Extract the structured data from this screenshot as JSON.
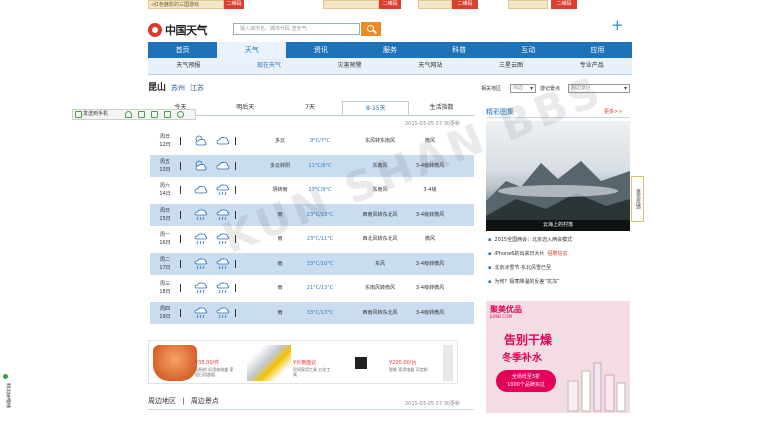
{
  "top_ads": {
    "text1": "«红色魅影的三国游戏",
    "tag1": "二维码",
    "tag2": "二维码",
    "tag3": "二维码",
    "tag4": "二维码"
  },
  "header": {
    "logo": "中国天气",
    "search_placeholder": "输入城市名、城市代码 查天气",
    "plus": "+"
  },
  "nav": {
    "items": [
      "首页",
      "天气",
      "资讯",
      "服务",
      "科普",
      "互动",
      "应用"
    ],
    "active_index": 1
  },
  "subnav": {
    "items": [
      "天气预报",
      "现在天气",
      "灾害预警",
      "天气网站",
      "三星云图",
      "专业产品"
    ]
  },
  "location": {
    "city": "昆山",
    "parent1": "苏州",
    "parent2": "江苏",
    "related_label": "相关地区",
    "related_value": "周边",
    "travel_label": "游记景点",
    "travel_value": "周边景区"
  },
  "forecast": {
    "tabs": [
      "今天",
      "明后天",
      "7天",
      "8-15天",
      "生活指数"
    ],
    "active_tab_index": 3,
    "updated": "2015-03-05 07:30更新",
    "rows": [
      {
        "day": "周日",
        "date": "12日",
        "desc": "多云",
        "temp": "9°C/7°C",
        "wind_dir": "东风转东南风",
        "wind_level": "微风"
      },
      {
        "day": "周五",
        "date": "13日",
        "desc": "多云转阴",
        "temp": "11°C/6°C",
        "wind_dir": "东南风",
        "wind_level": "3-4级转微风"
      },
      {
        "day": "周六",
        "date": "14日",
        "desc": "阴转雨",
        "temp": "17°C/9°C",
        "wind_dir": "东南风",
        "wind_level": "3-4级"
      },
      {
        "day": "周日",
        "date": "15日",
        "desc": "雨",
        "temp": "23°C/13°C",
        "wind_dir": "西南风转东北风",
        "wind_level": "3-4级转微风"
      },
      {
        "day": "周一",
        "date": "16日",
        "desc": "雨",
        "temp": "23°C/11°C",
        "wind_dir": "西北风转东北风",
        "wind_level": "微风"
      },
      {
        "day": "周二",
        "date": "17日",
        "desc": "雨",
        "temp": "33°C/10°C",
        "wind_dir": "东风",
        "wind_level": "3-4级转微风"
      },
      {
        "day": "周三",
        "date": "18日",
        "desc": "雨",
        "temp": "21°C/13°C",
        "wind_dir": "东南风转南风",
        "wind_level": "3-4级转微风"
      },
      {
        "day": "周四",
        "date": "19日",
        "desc": "雨",
        "temp": "33°C/13°C",
        "wind_dir": "西南风转东北风",
        "wind_level": "3-4级转微风"
      }
    ]
  },
  "bottom_ads": {
    "price1": "¥38.00/件",
    "text1": "妈妈的 好用收纳盒 家居日用超值",
    "price2": "¥价格面议",
    "text2": "民间家用工具 五金工具",
    "price3": "¥200.00/台",
    "text3": "智能 家用电器 可定制"
  },
  "nearby": {
    "title1": "周边地区",
    "title2": "周边景点",
    "updated": "2015-03-05 07:30更新"
  },
  "sidebar": {
    "title": "精彩图集",
    "more": "更多>>",
    "photo_caption": "云海上的村落",
    "news": [
      {
        "text": "2015全国两会：北京迈入两会模式",
        "hot": ""
      },
      {
        "text": "iPhone6的出来日大片",
        "hot": "招聘信息"
      },
      {
        "text": "北京冰雪节·东北风雪已至",
        "hot": ""
      },
      {
        "text": "为何？极寒降温的反差“抗冻”",
        "hot": ""
      }
    ],
    "jumei_logo": "聚美优品",
    "jumei_sub": "JUMEI.COM",
    "jumei_h1": "告别干燥",
    "jumei_h2": "冬季补水",
    "jumei_badge1": "全场低至3折",
    "jumei_badge2": "1000个品牌买过",
    "feedback": "意见反馈"
  },
  "toolbar": {
    "label": "发送到手机"
  },
  "left_bar": {
    "label": "请分享通道"
  },
  "watermark": "KUN SHAN BBS"
}
